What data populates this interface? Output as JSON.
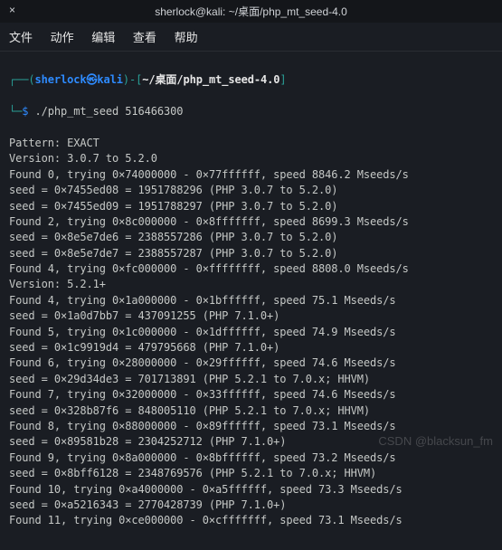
{
  "titlebar": {
    "title": "sherlock@kali: ~/桌面/php_mt_seed-4.0",
    "close_icon": "×"
  },
  "menubar": {
    "file": "文件",
    "actions": "动作",
    "edit": "编辑",
    "view": "查看",
    "help": "帮助"
  },
  "prompt": {
    "open_bracket": "┌──(",
    "user": "sherlock",
    "at": "㉿",
    "host": "kali",
    "close_bracket": ")-[",
    "path_tilde": "~",
    "path_rest": "/桌面/php_mt_seed-4.0",
    "end_bracket": "]",
    "line2_prefix": "└─",
    "dollar": "$",
    "command": "./php_mt_seed 516466300"
  },
  "output": [
    "Pattern: EXACT",
    "Version: 3.0.7 to 5.2.0",
    "Found 0, trying 0×74000000 - 0×77ffffff, speed 8846.2 Mseeds/s",
    "seed = 0×7455ed08 = 1951788296 (PHP 3.0.7 to 5.2.0)",
    "seed = 0×7455ed09 = 1951788297 (PHP 3.0.7 to 5.2.0)",
    "Found 2, trying 0×8c000000 - 0×8fffffff, speed 8699.3 Mseeds/s",
    "seed = 0×8e5e7de6 = 2388557286 (PHP 3.0.7 to 5.2.0)",
    "seed = 0×8e5e7de7 = 2388557287 (PHP 3.0.7 to 5.2.0)",
    "Found 4, trying 0×fc000000 - 0×ffffffff, speed 8808.0 Mseeds/s",
    "Version: 5.2.1+",
    "Found 4, trying 0×1a000000 - 0×1bffffff, speed 75.1 Mseeds/s",
    "seed = 0×1a0d7bb7 = 437091255 (PHP 7.1.0+)",
    "Found 5, trying 0×1c000000 - 0×1dffffff, speed 74.9 Mseeds/s",
    "seed = 0×1c9919d4 = 479795668 (PHP 7.1.0+)",
    "Found 6, trying 0×28000000 - 0×29ffffff, speed 74.6 Mseeds/s",
    "seed = 0×29d34de3 = 701713891 (PHP 5.2.1 to 7.0.x; HHVM)",
    "Found 7, trying 0×32000000 - 0×33ffffff, speed 74.6 Mseeds/s",
    "seed = 0×328b87f6 = 848005110 (PHP 5.2.1 to 7.0.x; HHVM)",
    "Found 8, trying 0×88000000 - 0×89ffffff, speed 73.1 Mseeds/s",
    "seed = 0×89581b28 = 2304252712 (PHP 7.1.0+)",
    "Found 9, trying 0×8a000000 - 0×8bffffff, speed 73.2 Mseeds/s",
    "seed = 0×8bff6128 = 2348769576 (PHP 5.2.1 to 7.0.x; HHVM)",
    "Found 10, trying 0×a4000000 - 0×a5ffffff, speed 73.3 Mseeds/s",
    "seed = 0×a5216343 = 2770428739 (PHP 7.1.0+)",
    "Found 11, trying 0×ce000000 - 0×cfffffff, speed 73.1 Mseeds/s"
  ],
  "watermark": "CSDN @blacksun_fm"
}
